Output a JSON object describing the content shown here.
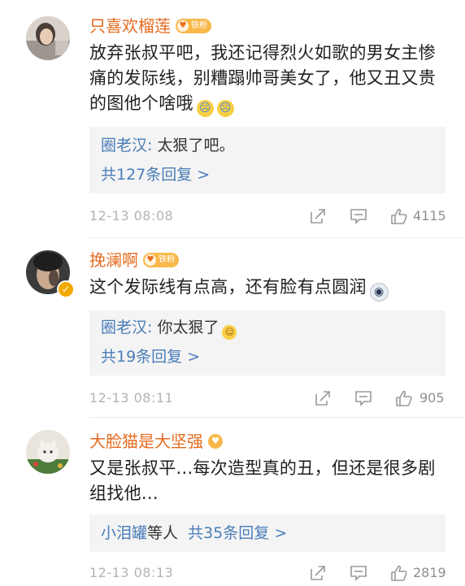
{
  "comments": [
    {
      "username": "只喜欢榴莲",
      "fan_badge": "铁粉",
      "text": "放弃张叔平吧，我还记得烈火如歌的男女主惨痛的发际线，别糟蹋帅哥美女了，他又丑又贵的图他个啥哦",
      "emojis": [
        "crying",
        "crying"
      ],
      "reply": {
        "replier": "圈老汉",
        "text": "太狠了吧。"
      },
      "reply_more": "共127条回复 >",
      "time": "12-13 08:08",
      "likes": "4115"
    },
    {
      "username": "挽澜啊",
      "fan_badge": "铁粉",
      "verified": true,
      "text": "这个发际线有点高，还有脸有点圆润",
      "emojis": [
        "shocked"
      ],
      "reply": {
        "replier": "圈老汉",
        "text": "你太狠了"
      },
      "reply_more": "共19条回复 >",
      "time": "12-13 08:11",
      "likes": "905"
    },
    {
      "username": "大脸猫是大坚强",
      "text": "又是张叔平...每次造型真的丑，但还是很多剧组找他...",
      "reply_users": "小泪罐",
      "reply_users_suffix": "等人",
      "reply_more": "共35条回复 >",
      "time": "12-13 08:13",
      "likes": "2819"
    }
  ],
  "colors": {
    "username": "#e56a1e",
    "link": "#4a7db8",
    "muted": "#b3b3b3",
    "reply_bg": "#f4f4f4",
    "badge": "#f8b84a"
  },
  "icons": [
    "share-icon",
    "comment-icon",
    "like-icon",
    "verified-icon",
    "fan-heart-icon"
  ]
}
